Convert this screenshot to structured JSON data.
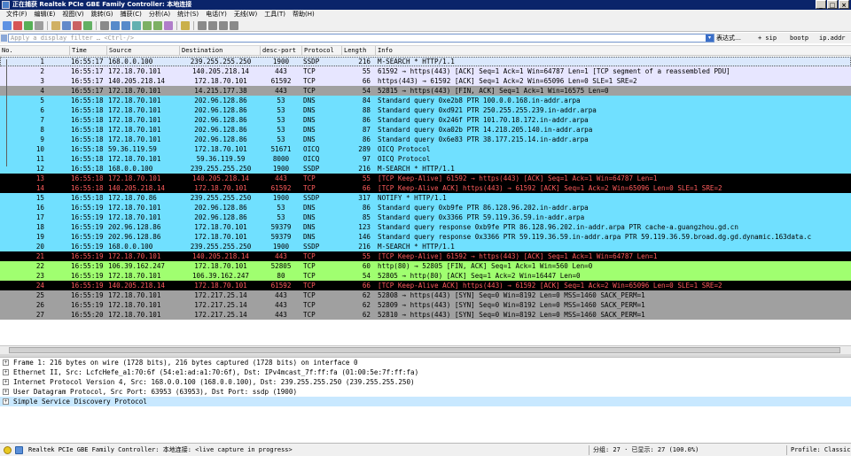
{
  "window": {
    "title": "正在捕获 Realtek PCIe GBE Family Controller: 本地连接"
  },
  "menu": [
    "文件(F)",
    "编辑(E)",
    "视图(V)",
    "跳转(G)",
    "捕获(C)",
    "分析(A)",
    "统计(S)",
    "电话(Y)",
    "无线(W)",
    "工具(T)",
    "帮助(H)"
  ],
  "toolbar": {
    "icons": [
      "shark-fin-start-icon",
      "stop-icon",
      "restart-icon",
      "options-icon",
      "open-file-icon",
      "save-file-icon",
      "close-file-icon",
      "reload-icon",
      "find-icon",
      "back-icon",
      "forward-icon",
      "goto-icon",
      "first-icon",
      "last-icon",
      "autoscroll-icon",
      "colorize-icon",
      "zoom-in-icon",
      "zoom-out-icon",
      "zoom-reset-icon",
      "resize-columns-icon"
    ]
  },
  "filter": {
    "placeholder": "Apply a display filter … <Ctrl-/>",
    "expression_label": "表达式…",
    "quick": [
      "+ sip",
      "bootp",
      "ip.addr"
    ]
  },
  "columns": [
    "No.",
    "Time",
    "Source",
    "Destination",
    "desc-port",
    "Protocol",
    "Length",
    "Info"
  ],
  "colors": {
    "udp": "#dae8fc",
    "tcp": "#e7e6ff",
    "fin": "#a0a0a0",
    "dns": "#70e0ff",
    "bad": "#000000",
    "bad_fg": "#ff5c5c",
    "http": "#a0ff70",
    "syn": "#a0a0a0",
    "selected": "#c8e8ff"
  },
  "packets": [
    {
      "no": "1",
      "time": "16:55:17",
      "src": "168.0.0.100",
      "dst": "239.255.255.250",
      "port": "1900",
      "proto": "SSDP",
      "len": "216",
      "info": "M-SEARCH * HTTP/1.1",
      "style": "udp"
    },
    {
      "no": "2",
      "time": "16:55:17",
      "src": "172.18.70.101",
      "dst": "140.205.218.14",
      "port": "443",
      "proto": "TCP",
      "len": "55",
      "info": "61592 → https(443) [ACK] Seq=1 Ack=1 Win=64787 Len=1 [TCP segment of a reassembled PDU]",
      "style": "tcp"
    },
    {
      "no": "3",
      "time": "16:55:17",
      "src": "140.205.218.14",
      "dst": "172.18.70.101",
      "port": "61592",
      "proto": "TCP",
      "len": "66",
      "info": "https(443) → 61592 [ACK] Seq=1 Ack=2 Win=65096 Len=0 SLE=1 SRE=2",
      "style": "tcp"
    },
    {
      "no": "4",
      "time": "16:55:17",
      "src": "172.18.70.101",
      "dst": "14.215.177.38",
      "port": "443",
      "proto": "TCP",
      "len": "54",
      "info": "52815 → https(443) [FIN, ACK] Seq=1 Ack=1 Win=16575 Len=0",
      "style": "fin"
    },
    {
      "no": "5",
      "time": "16:55:18",
      "src": "172.18.70.101",
      "dst": "202.96.128.86",
      "port": "53",
      "proto": "DNS",
      "len": "84",
      "info": "Standard query 0xe2b8 PTR 100.0.0.168.in-addr.arpa",
      "style": "dns"
    },
    {
      "no": "6",
      "time": "16:55:18",
      "src": "172.18.70.101",
      "dst": "202.96.128.86",
      "port": "53",
      "proto": "DNS",
      "len": "88",
      "info": "Standard query 0xd921 PTR 250.255.255.239.in-addr.arpa",
      "style": "dns"
    },
    {
      "no": "7",
      "time": "16:55:18",
      "src": "172.18.70.101",
      "dst": "202.96.128.86",
      "port": "53",
      "proto": "DNS",
      "len": "86",
      "info": "Standard query 0x246f PTR 101.70.18.172.in-addr.arpa",
      "style": "dns"
    },
    {
      "no": "8",
      "time": "16:55:18",
      "src": "172.18.70.101",
      "dst": "202.96.128.86",
      "port": "53",
      "proto": "DNS",
      "len": "87",
      "info": "Standard query 0xa02b PTR 14.218.205.140.in-addr.arpa",
      "style": "dns"
    },
    {
      "no": "9",
      "time": "16:55:18",
      "src": "172.18.70.101",
      "dst": "202.96.128.86",
      "port": "53",
      "proto": "DNS",
      "len": "86",
      "info": "Standard query 0x6e83 PTR 38.177.215.14.in-addr.arpa",
      "style": "dns"
    },
    {
      "no": "10",
      "time": "16:55:18",
      "src": "59.36.119.59",
      "dst": "172.18.70.101",
      "port": "51671",
      "proto": "OICQ",
      "len": "289",
      "info": "OICQ Protocol",
      "style": "dns"
    },
    {
      "no": "11",
      "time": "16:55:18",
      "src": "172.18.70.101",
      "dst": "59.36.119.59",
      "port": "8000",
      "proto": "OICQ",
      "len": "97",
      "info": "OICQ Protocol",
      "style": "dns"
    },
    {
      "no": "12",
      "time": "16:55:18",
      "src": "168.0.0.100",
      "dst": "239.255.255.250",
      "port": "1900",
      "proto": "SSDP",
      "len": "216",
      "info": "M-SEARCH * HTTP/1.1",
      "style": "dns"
    },
    {
      "no": "13",
      "time": "16:55:18",
      "src": "172.18.70.101",
      "dst": "140.205.218.14",
      "port": "443",
      "proto": "TCP",
      "len": "55",
      "info": "[TCP Keep-Alive] 61592 → https(443) [ACK] Seq=1 Ack=1 Win=64787 Len=1",
      "style": "bad"
    },
    {
      "no": "14",
      "time": "16:55:18",
      "src": "140.205.218.14",
      "dst": "172.18.70.101",
      "port": "61592",
      "proto": "TCP",
      "len": "66",
      "info": "[TCP Keep-Alive ACK] https(443) → 61592 [ACK] Seq=1 Ack=2 Win=65096 Len=0 SLE=1 SRE=2",
      "style": "bad"
    },
    {
      "no": "15",
      "time": "16:55:18",
      "src": "172.18.70.86",
      "dst": "239.255.255.250",
      "port": "1900",
      "proto": "SSDP",
      "len": "317",
      "info": "NOTIFY * HTTP/1.1",
      "style": "dns"
    },
    {
      "no": "16",
      "time": "16:55:19",
      "src": "172.18.70.101",
      "dst": "202.96.128.86",
      "port": "53",
      "proto": "DNS",
      "len": "86",
      "info": "Standard query 0xb9fe PTR 86.128.96.202.in-addr.arpa",
      "style": "dns"
    },
    {
      "no": "17",
      "time": "16:55:19",
      "src": "172.18.70.101",
      "dst": "202.96.128.86",
      "port": "53",
      "proto": "DNS",
      "len": "85",
      "info": "Standard query 0x3366 PTR 59.119.36.59.in-addr.arpa",
      "style": "dns"
    },
    {
      "no": "18",
      "time": "16:55:19",
      "src": "202.96.128.86",
      "dst": "172.18.70.101",
      "port": "59379",
      "proto": "DNS",
      "len": "123",
      "info": "Standard query response 0xb9fe PTR 86.128.96.202.in-addr.arpa PTR cache-a.guangzhou.gd.cn",
      "style": "dns"
    },
    {
      "no": "19",
      "time": "16:55:19",
      "src": "202.96.128.86",
      "dst": "172.18.70.101",
      "port": "59379",
      "proto": "DNS",
      "len": "146",
      "info": "Standard query response 0x3366 PTR 59.119.36.59.in-addr.arpa PTR 59.119.36.59.broad.dg.gd.dynamic.163data.c",
      "style": "dns"
    },
    {
      "no": "20",
      "time": "16:55:19",
      "src": "168.0.0.100",
      "dst": "239.255.255.250",
      "port": "1900",
      "proto": "SSDP",
      "len": "216",
      "info": "M-SEARCH * HTTP/1.1",
      "style": "dns"
    },
    {
      "no": "21",
      "time": "16:55:19",
      "src": "172.18.70.101",
      "dst": "140.205.218.14",
      "port": "443",
      "proto": "TCP",
      "len": "55",
      "info": "[TCP Keep-Alive] 61592 → https(443) [ACK] Seq=1 Ack=1 Win=64787 Len=1",
      "style": "bad"
    },
    {
      "no": "22",
      "time": "16:55:19",
      "src": "106.39.162.247",
      "dst": "172.18.70.101",
      "port": "52805",
      "proto": "TCP",
      "len": "60",
      "info": "http(80) → 52805 [FIN, ACK] Seq=1 Ack=1 Win=560 Len=0",
      "style": "http"
    },
    {
      "no": "23",
      "time": "16:55:19",
      "src": "172.18.70.101",
      "dst": "106.39.162.247",
      "port": "80",
      "proto": "TCP",
      "len": "54",
      "info": "52805 → http(80) [ACK] Seq=1 Ack=2 Win=16447 Len=0",
      "style": "http"
    },
    {
      "no": "24",
      "time": "16:55:19",
      "src": "140.205.218.14",
      "dst": "172.18.70.101",
      "port": "61592",
      "proto": "TCP",
      "len": "66",
      "info": "[TCP Keep-Alive ACK] https(443) → 61592 [ACK] Seq=1 Ack=2 Win=65096 Len=0 SLE=1 SRE=2",
      "style": "bad"
    },
    {
      "no": "25",
      "time": "16:55:19",
      "src": "172.18.70.101",
      "dst": "172.217.25.14",
      "port": "443",
      "proto": "TCP",
      "len": "62",
      "info": "52808 → https(443) [SYN] Seq=0 Win=8192 Len=0 MSS=1460 SACK_PERM=1",
      "style": "syn"
    },
    {
      "no": "26",
      "time": "16:55:19",
      "src": "172.18.70.101",
      "dst": "172.217.25.14",
      "port": "443",
      "proto": "TCP",
      "len": "62",
      "info": "52809 → https(443) [SYN] Seq=0 Win=8192 Len=0 MSS=1460 SACK_PERM=1",
      "style": "syn"
    },
    {
      "no": "27",
      "time": "16:55:20",
      "src": "172.18.70.101",
      "dst": "172.217.25.14",
      "port": "443",
      "proto": "TCP",
      "len": "62",
      "info": "52810 → https(443) [SYN] Seq=0 Win=8192 Len=0 MSS=1460 SACK_PERM=1",
      "style": "syn"
    }
  ],
  "details": [
    {
      "text": "Frame 1: 216 bytes on wire (1728 bits), 216 bytes captured (1728 bits) on interface 0",
      "selected": false
    },
    {
      "text": "Ethernet II, Src: LcfcHefe_a1:70:6f (54:e1:ad:a1:70:6f), Dst: IPv4mcast_7f:ff:fa (01:00:5e:7f:ff:fa)",
      "selected": false
    },
    {
      "text": "Internet Protocol Version 4, Src: 168.0.0.100 (168.0.0.100), Dst: 239.255.255.250 (239.255.255.250)",
      "selected": false
    },
    {
      "text": "User Datagram Protocol, Src Port: 63953 (63953), Dst Port: ssdp (1900)",
      "selected": false
    },
    {
      "text": "Simple Service Discovery Protocol",
      "selected": true
    }
  ],
  "status": {
    "interface": "Realtek PCIe GBE Family Controller: 本地连接: <live capture in progress>",
    "packets": "分组: 27 · 已显示: 27 (100.0%)",
    "profile": "Profile: Classic"
  }
}
